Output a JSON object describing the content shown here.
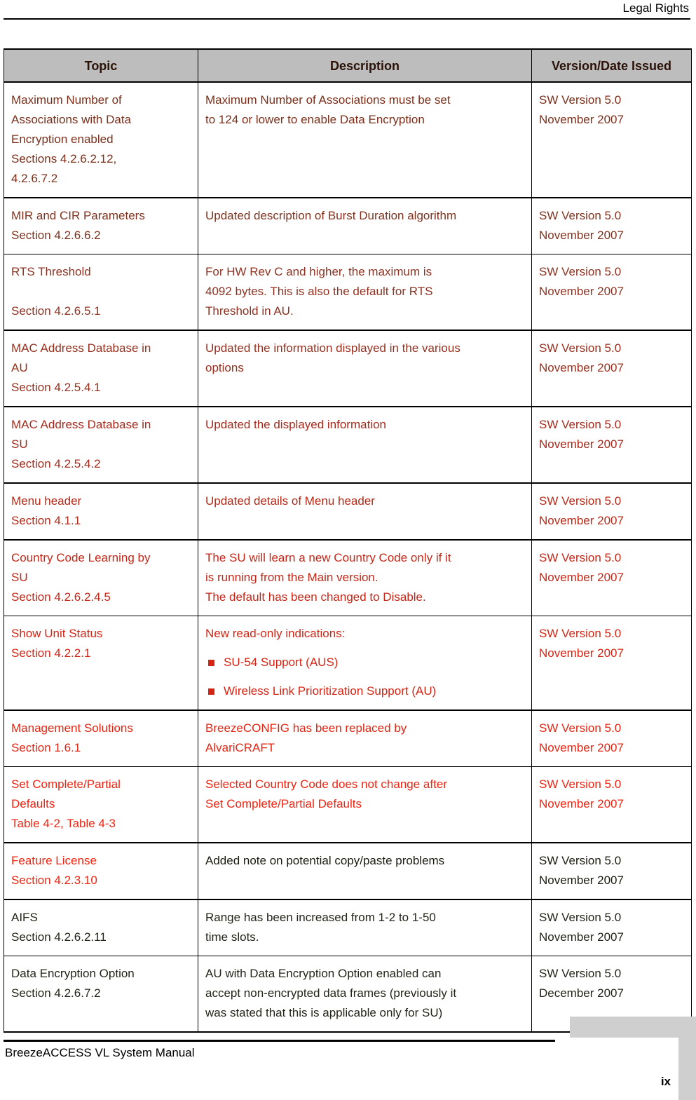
{
  "header": {
    "title": "Legal Rights"
  },
  "table": {
    "columns": [
      "Topic",
      "Description",
      "Version/Date Issued"
    ],
    "rows": [
      {
        "color": "#7a2f1b",
        "topic": "Maximum Number of\nAssociations with Data\nEncryption enabled\nSections 4.2.6.2.12,\n4.2.6.7.2",
        "description": "Maximum Number of Associations must be set\nto 124 or lower to enable Data Encryption",
        "version": "SW Version 5.0\nNovember 2007",
        "thick_bottom": true
      },
      {
        "color": "#7f3320",
        "topic": "MIR and CIR Parameters\nSection 4.2.6.6.2",
        "description": "Updated description of Burst Duration algorithm",
        "version": "SW Version 5.0\nNovember 2007",
        "thick_bottom": false
      },
      {
        "color": "#8e3222",
        "topic": "RTS Threshold\n\nSection 4.2.6.5.1",
        "description": "For HW Rev C and higher, the maximum is\n4092 bytes. This is also the default for RTS\nThreshold in AU.",
        "version": "SW Version 5.0\nNovember 2007",
        "thick_bottom": true
      },
      {
        "color": "#97301e",
        "topic": "MAC Address Database in\nAU\nSection 4.2.5.4.1",
        "description": "Updated the information displayed in the various\noptions",
        "version": "SW Version 5.0\nNovember 2007",
        "thick_bottom": true
      },
      {
        "color": "#a52a1c",
        "topic": "MAC Address Database in\nSU\nSection 4.2.5.4.2",
        "description": "Updated the displayed information",
        "version": "SW Version 5.0\nNovember 2007",
        "thick_bottom": true
      },
      {
        "color": "#b52a18",
        "topic": "Menu header\nSection 4.1.1",
        "description": "Updated details of Menu header",
        "version": "SW Version 5.0\nNovember 2007",
        "thick_bottom": true
      },
      {
        "color": "#c42718",
        "topic": "Country Code Learning by\nSU\nSection 4.2.6.2.4.5",
        "description": "The SU will learn a new Country Code only if it\nis running from the Main version.\nThe default has been changed to Disable.",
        "version": "SW Version 5.0\nNovember 2007",
        "thick_bottom": false
      },
      {
        "color": "#d42514",
        "topic": "Show Unit Status\nSection 4.2.2.1",
        "description_intro": "New read-only indications:",
        "bullets": [
          "SU-54 Support (AUS)",
          "Wireless Link Prioritization Support (AU)"
        ],
        "version": "SW Version 5.0\nNovember 2007",
        "thick_bottom": true
      },
      {
        "color": "#e32613",
        "topic": "Management Solutions\nSection 1.6.1",
        "description": "BreezeCONFIG has been replaced by\nAlvariCRAFT",
        "version": "SW Version 5.0\nNovember 2007",
        "thick_bottom": false
      },
      {
        "color": "#ef2411",
        "topic": "Set Complete/Partial\nDefaults\nTable 4-2, Table 4-3",
        "description": "Selected Country Code does not change after\nSet Complete/Partial Defaults",
        "version": "SW Version 5.0\nNovember 2007",
        "thick_bottom": true
      },
      {
        "color": "#1a1a10",
        "topic_color": "#f32410",
        "topic": "Feature License\nSection 4.2.3.10",
        "description": "Added note on potential copy/paste problems",
        "version": "SW Version 5.0\nNovember 2007",
        "thick_bottom": true
      },
      {
        "color": "#24241a",
        "topic": "AIFS\nSection 4.2.6.2.11",
        "description": "Range has been increased from 1-2 to 1-50\ntime slots.",
        "version": "SW Version 5.0\nNovember 2007",
        "thick_bottom": false
      },
      {
        "color": "#24241a",
        "topic": "Data Encryption Option\nSection 4.2.6.7.2",
        "description": "AU with Data Encryption Option enabled can\naccept non-encrypted data frames (previously it\nwas stated that this is applicable only for SU)",
        "version": "SW Version 5.0\nDecember 2007",
        "thick_bottom": true
      }
    ]
  },
  "footer": {
    "manual_title": "BreezeACCESS VL System Manual",
    "page_number": "ix"
  }
}
